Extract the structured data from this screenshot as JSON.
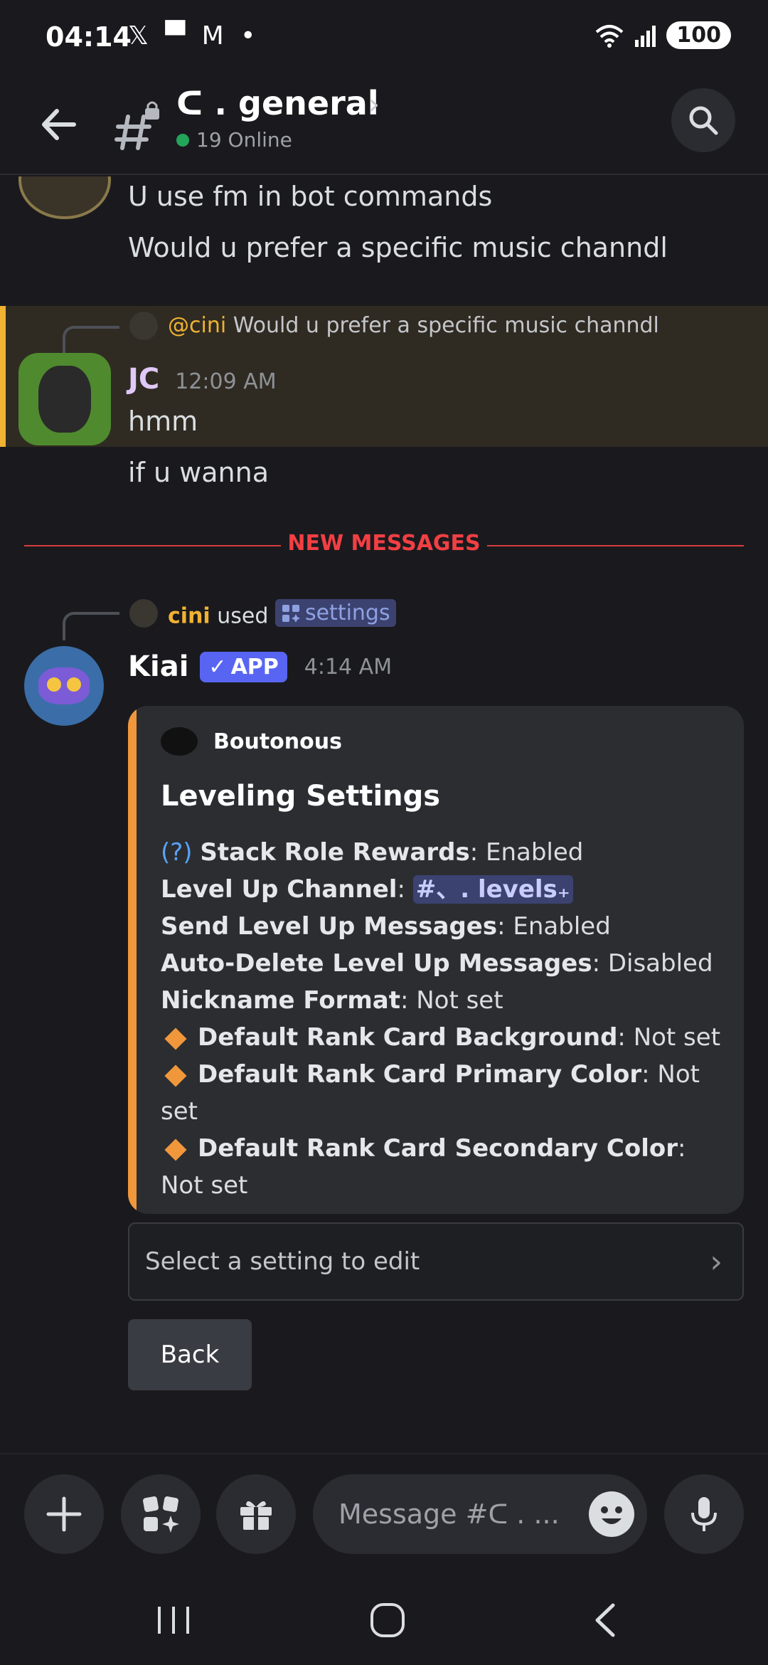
{
  "status_bar": {
    "time": "04:14",
    "notification_icons": "𝕏 ▀ M •",
    "battery": "100"
  },
  "header": {
    "channel_name": "ᑕ . general",
    "online_count": "19 Online"
  },
  "messages": {
    "prev_line_1": "U use fm in bot commands",
    "prev_line_2": "Would u prefer a specific music channdl",
    "reply_to_author": "@cini",
    "reply_to_text": "Would u prefer a specific music channdl",
    "jc_author": "JC",
    "jc_time": "12:09 AM",
    "jc_line_1": "hmm",
    "jc_line_2": "if u wanna",
    "new_messages_label": "NEW MESSAGES",
    "cmd_user": "cini",
    "cmd_used": "used",
    "cmd_name": "settings",
    "bot_author": "Kiai",
    "bot_badge": "APP",
    "bot_time": "4:14 AM"
  },
  "embed": {
    "author": "Boutonous",
    "title": "Leveling Settings",
    "help_marker": "(?)",
    "rows": [
      {
        "label": "Stack Role Rewards",
        "value": "Enabled"
      },
      {
        "label": "Level Up Channel",
        "value": "#、. levels₊"
      },
      {
        "label": "Send Level Up Messages",
        "value": "Enabled"
      },
      {
        "label": "Auto-Delete Level Up Messages",
        "value": "Disabled"
      },
      {
        "label": "Nickname Format",
        "value": "Not set"
      },
      {
        "label": "Default Rank Card Background",
        "value": "Not set"
      },
      {
        "label": "Default Rank Card Primary Color",
        "value": "Not set"
      },
      {
        "label": "Default Rank Card Secondary Color",
        "value": "Not set"
      }
    ],
    "accent_color": "#f0973c"
  },
  "components": {
    "select_placeholder": "Select a setting to edit",
    "back_label": "Back"
  },
  "composer": {
    "placeholder": "Message #ᑕ . ..."
  }
}
